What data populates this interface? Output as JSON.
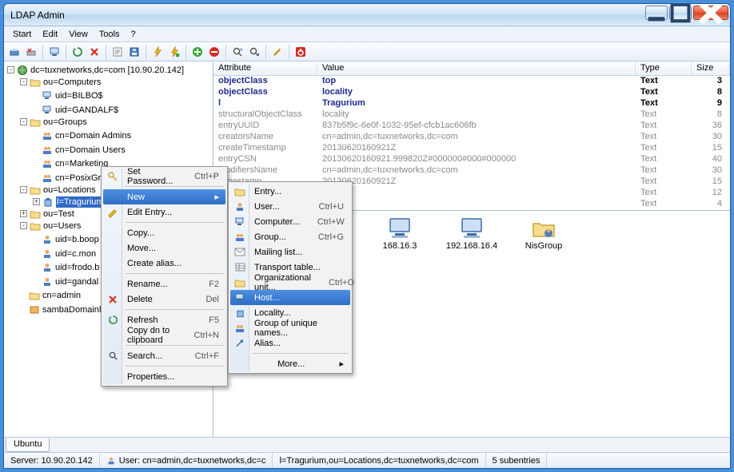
{
  "window": {
    "title": "LDAP Admin"
  },
  "menubar": [
    "Start",
    "Edit",
    "View",
    "Tools",
    "?"
  ],
  "toolbar_icons": [
    "connect-icon",
    "disconnect-icon",
    "sep",
    "computer-icon",
    "sep",
    "refresh-icon",
    "delete-red-icon",
    "sep",
    "properties-icon",
    "save-icon",
    "sep",
    "lightning-icon",
    "lightning2-icon",
    "sep",
    "add-green-icon",
    "stop-icon",
    "sep",
    "search-up-icon",
    "search-dn-icon",
    "sep",
    "wand-icon",
    "sep",
    "exit-icon"
  ],
  "tree": {
    "root": {
      "label": "dc=tuxnetworks,dc=com [10.90.20.142]",
      "expand": "-"
    },
    "computers": {
      "label": "ou=Computers",
      "expand": "-"
    },
    "bilbo": {
      "label": "uid=BILBO$"
    },
    "gandalf": {
      "label": "uid=GANDALF$"
    },
    "groups": {
      "label": "ou=Groups",
      "expand": "-"
    },
    "domadmins": {
      "label": "cn=Domain Admins"
    },
    "domusers": {
      "label": "cn=Domain Users"
    },
    "marketing": {
      "label": "cn=Marketing"
    },
    "posix": {
      "label": "cn=PosixGroup"
    },
    "locations": {
      "label": "ou=Locations",
      "expand": "-"
    },
    "tragurium": {
      "label": "l=Tragurium",
      "expand": "+"
    },
    "test": {
      "label": "ou=Test",
      "expand": "+"
    },
    "users": {
      "label": "ou=Users",
      "expand": "-"
    },
    "bboop": {
      "label": "uid=b.boop"
    },
    "cmon": {
      "label": "uid=c.mon"
    },
    "frodo": {
      "label": "uid=frodo.b"
    },
    "gandal": {
      "label": "uid=gandal"
    },
    "cnadmin": {
      "label": "cn=admin"
    },
    "samba": {
      "label": "sambaDomainN"
    }
  },
  "attr": {
    "cols": {
      "attr": "Attribute",
      "val": "Value",
      "type": "Type",
      "size": "Size"
    },
    "rows": [
      {
        "a": "objectClass",
        "v": "top",
        "t": "Text",
        "s": "3",
        "style": "bold"
      },
      {
        "a": "objectClass",
        "v": "locality",
        "t": "Text",
        "s": "8",
        "style": "bold"
      },
      {
        "a": "l",
        "v": "Tragurium",
        "t": "Text",
        "s": "9",
        "style": "bold"
      },
      {
        "a": "structuralObjectClass",
        "v": "locality",
        "t": "Text",
        "s": "8",
        "style": "gray"
      },
      {
        "a": "entryUUID",
        "v": "837b5f9c-6e0f-1032-95ef-cfcb1ac606fb",
        "t": "Text",
        "s": "36",
        "style": "gray"
      },
      {
        "a": "creatorsName",
        "v": "cn=admin,dc=tuxnetworks,dc=com",
        "t": "Text",
        "s": "30",
        "style": "gray"
      },
      {
        "a": "createTimestamp",
        "v": "20130620160921Z",
        "t": "Text",
        "s": "15",
        "style": "gray"
      },
      {
        "a": "entryCSN",
        "v": "20130620160921.999820Z#000000#000#000000",
        "t": "Text",
        "s": "40",
        "style": "gray"
      },
      {
        "a": "modifiersName",
        "v": "cn=admin,dc=tuxnetworks,dc=com",
        "t": "Text",
        "s": "30",
        "style": "gray"
      },
      {
        "a": "Timestamp",
        "v": "20130620160921Z",
        "t": "Text",
        "s": "15",
        "style": "gray"
      },
      {
        "a": "",
        "v": "",
        "t": "Text",
        "s": "12",
        "style": "gray"
      },
      {
        "a": "",
        "v": "",
        "t": "Text",
        "s": "4",
        "style": "gray"
      }
    ]
  },
  "icons_area": [
    {
      "label": "168.16.3"
    },
    {
      "label": "192.168.16.4"
    },
    {
      "label": "NisGroup"
    }
  ],
  "tab": "Ubuntu",
  "status": {
    "server": "Server: 10.90.20.142",
    "user": "User: cn=admin,dc=tuxnetworks,dc=c",
    "path": "l=Tragurium,ou=Locations,dc=tuxnetworks,dc=com",
    "count": "5 subentries"
  },
  "ctx1": {
    "setpw": {
      "label": "Set Password...",
      "sc": "Ctrl+P"
    },
    "new": {
      "label": "New"
    },
    "edit": {
      "label": "Edit Entry..."
    },
    "copy": {
      "label": "Copy..."
    },
    "move": {
      "label": "Move..."
    },
    "alias": {
      "label": "Create alias..."
    },
    "rename": {
      "label": "Rename...",
      "sc": "F2"
    },
    "delete": {
      "label": "Delete",
      "sc": "Del"
    },
    "refresh": {
      "label": "Refresh",
      "sc": "F5"
    },
    "copydn": {
      "label": "Copy dn to clipboard",
      "sc": "Ctrl+N"
    },
    "search": {
      "label": "Search...",
      "sc": "Ctrl+F"
    },
    "props": {
      "label": "Properties..."
    }
  },
  "ctx2": {
    "entry": {
      "label": "Entry..."
    },
    "user": {
      "label": "User...",
      "sc": "Ctrl+U"
    },
    "computer": {
      "label": "Computer...",
      "sc": "Ctrl+W"
    },
    "group": {
      "label": "Group...",
      "sc": "Ctrl+G"
    },
    "mlist": {
      "label": "Mailing list..."
    },
    "ttable": {
      "label": "Transport table..."
    },
    "ou": {
      "label": "Organizational unit...",
      "sc": "Ctrl+O"
    },
    "host": {
      "label": "Host..."
    },
    "locality": {
      "label": "Locality..."
    },
    "goun": {
      "label": "Group of unique names..."
    },
    "alias": {
      "label": "Alias..."
    },
    "more": {
      "label": "More..."
    }
  }
}
